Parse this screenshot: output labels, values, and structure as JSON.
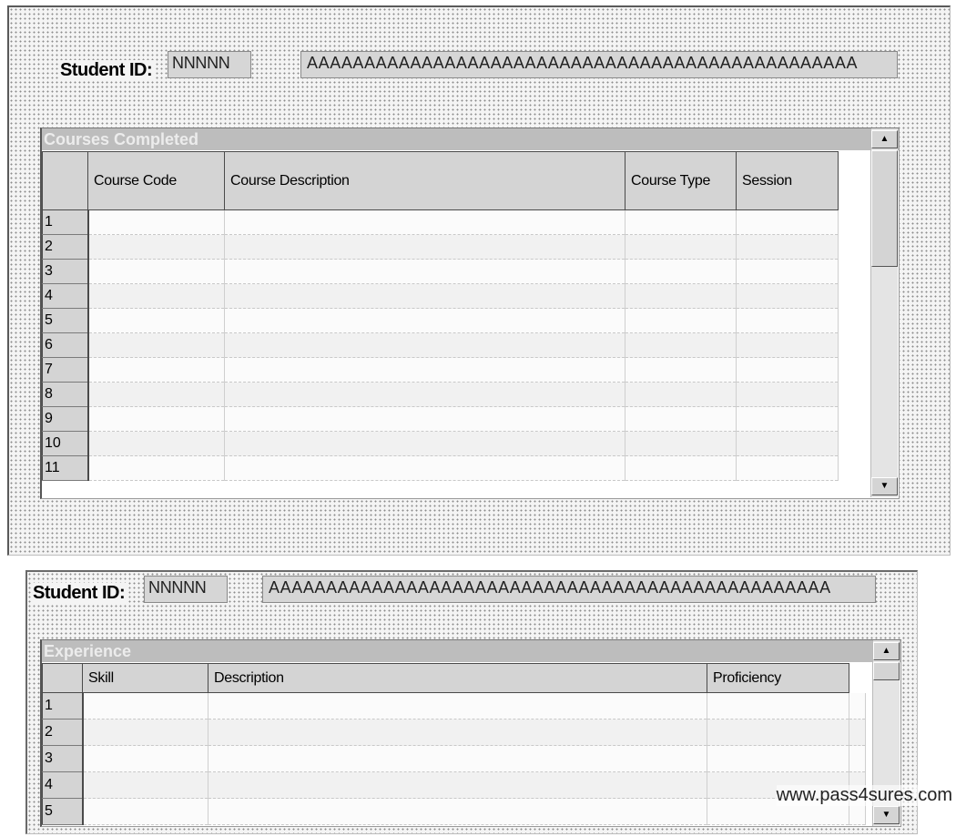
{
  "form1": {
    "student_id_label": "Student ID:",
    "student_id_value": "NNNNN",
    "name_value": "AAAAAAAAAAAAAAAAAAAAAAAAAAAAAAAAAAAAAAAAAAAAAAAA",
    "subform": {
      "title": "Courses Completed",
      "columns": [
        "Course Code",
        "Course Description",
        "Course Type",
        "Session"
      ],
      "rows": [
        "1",
        "2",
        "3",
        "4",
        "5",
        "6",
        "7",
        "8",
        "9",
        "10",
        "11"
      ]
    }
  },
  "form2": {
    "student_id_label": "Student ID:",
    "student_id_value": "NNNNN",
    "name_value": "AAAAAAAAAAAAAAAAAAAAAAAAAAAAAAAAAAAAAAAAAAAAAAAAA",
    "subform": {
      "title": "Experience",
      "columns": [
        "Skill",
        "Description",
        "Proficiency"
      ],
      "rows": [
        "1",
        "2",
        "3",
        "4",
        "5"
      ]
    }
  },
  "watermark": "www.pass4sures.com",
  "icons": {
    "scroll_up": "triangle-up-icon",
    "scroll_down": "triangle-down-icon"
  }
}
